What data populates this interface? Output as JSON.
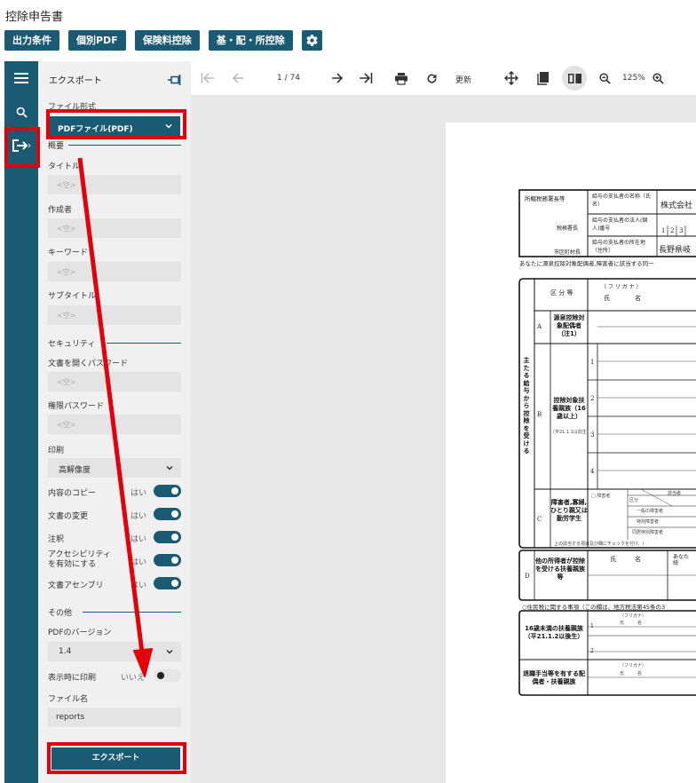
{
  "page_title": "控除申告書",
  "top_buttons": [
    "出力条件",
    "個別PDF",
    "保険料控除",
    "基・配・所控除"
  ],
  "icons": {
    "settings": "gear-icon",
    "menu": "hamburger-icon",
    "search": "search-icon",
    "export": "export-icon",
    "pin": "pin-icon",
    "first": "first-page-icon",
    "prev": "previous-page-icon",
    "next": "next-page-icon",
    "last": "last-page-icon",
    "print": "print-icon",
    "refresh": "refresh-icon",
    "move": "move-icon",
    "single_page": "single-page-icon",
    "book": "book-view-icon",
    "zoom_out": "zoom-out-icon",
    "zoom_in": "zoom-in-icon"
  },
  "colors": {
    "primary": "#1b5a73",
    "highlight": "#e1000b",
    "panel_bg": "#f0f0f0",
    "viewer_bg": "#e8e8e8"
  },
  "export_panel": {
    "title": "エクスポート",
    "format_label": "ファイル形式",
    "format_value": "PDFファイル(PDF)",
    "summary_section": "概要",
    "title_label": "タイトル",
    "author_label": "作成者",
    "keywords_label": "キーワード",
    "subtitle_label": "サブタイトル",
    "empty_placeholder": "<空>",
    "security_section": "セキュリティ",
    "open_password_label": "文書を開くパスワード",
    "permission_password_label": "権限パスワード",
    "print_label": "印刷",
    "print_value": "高解像度",
    "permissions": [
      {
        "label": "内容のコピー",
        "value": "はい"
      },
      {
        "label": "文書の変更",
        "value": "はい"
      },
      {
        "label": "注釈",
        "value": "はい"
      },
      {
        "label": "アクセシビリティを有効にする",
        "value": "はい"
      },
      {
        "label": "文書アセンブリ",
        "value": "はい"
      }
    ],
    "other_section": "その他",
    "pdf_version_label": "PDFのバージョン",
    "pdf_version_value": "1.4",
    "print_on_display_label": "表示時に印刷",
    "print_on_display_value": "いいえ",
    "filename_label": "ファイル名",
    "filename_value": "reports",
    "export_button": "エクスポート"
  },
  "viewer_toolbar": {
    "page_indicator": "1 / 74",
    "refresh_label": "更新",
    "zoom_level": "125%"
  },
  "document": {
    "r1_left": "所轄税務署長等",
    "r1_payer_name_label": "給与の支払者の名称（氏名）",
    "r1_payer_name_value": "株式会社",
    "r2_left": "税務署長",
    "r2_payer_number_label": "給与の支払者の法人(個人)番号",
    "r2_number_digits": [
      "1",
      "2",
      "3"
    ],
    "r3_left": "市区町村長",
    "r3_payer_address_label": "給与の支払者の所在地（住所）",
    "r3_payer_address_value": "長野県岐",
    "notice": "あなたに源泉控除対象配偶者,障害者に該当する同一",
    "header_kubun": "区 分 等",
    "header_furigana": "（ フ リ ガ ナ ）",
    "header_name": "氏　　　　名",
    "vertical_title": "主たる給与から控除を受ける",
    "sec_a_letter": "A",
    "sec_a_label": "源泉控除対象配偶者（注1）",
    "sec_b_letter": "B",
    "sec_b_label": "控除対象扶養親族（16歳以上）",
    "sec_b_sub": "(平21.1.1以前生)",
    "b_rows": [
      "1",
      "2",
      "3",
      "4"
    ],
    "sec_c_letter": "C",
    "sec_c_label": "障害者,寡婦,ひとり親又は勤労学生",
    "c_checkbox_label": "□ 障害者",
    "c_grid_items": [
      "区分",
      "一般の障害者",
      "特別障害者",
      "同居特別障害者"
    ],
    "c_grid_header": "該当者",
    "c_note": "上の該当する項目及び欄にチェックを付け,（",
    "sec_d_letter": "D",
    "sec_d_label": "他の所得者が控除を受ける扶養親族等",
    "d_name": "氏　　　名",
    "d_right": "あなた続",
    "resident_notice": "○住民税に関する事項（この欄は、地方税法第45条の3",
    "sec_e_label": "16歳未満の扶養親族（平21.1.2以後生）",
    "sec_e_furigana": "（フリガナ）",
    "sec_e_name": "氏　　　名",
    "e_rows": [
      "1",
      "2"
    ],
    "sec_f_label": "退職手当等を有する配偶者・扶養親族"
  }
}
